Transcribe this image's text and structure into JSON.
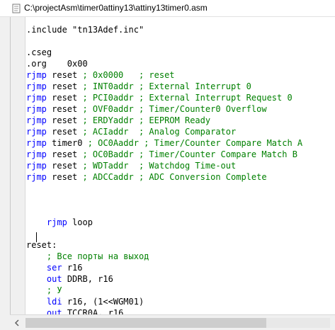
{
  "window": {
    "title": "C:\\projectAsm\\timer0attiny13\\attiny13timer0.asm",
    "icon": "document-icon"
  },
  "colors": {
    "keyword": "#0000ff",
    "comment": "#008000",
    "text": "#000000",
    "background": "#ffffff"
  },
  "code": {
    "lines": [
      [
        {
          "t": ".include \"tn13Adef.inc\"",
          "c": "plain"
        }
      ],
      [
        {
          "t": "",
          "c": "plain"
        }
      ],
      [
        {
          "t": ".cseg",
          "c": "plain"
        }
      ],
      [
        {
          "t": ".org    0x00",
          "c": "plain"
        }
      ],
      [
        {
          "t": "rjmp",
          "c": "kw"
        },
        {
          "t": " reset ",
          "c": "plain"
        },
        {
          "t": "; 0x0000   ; reset",
          "c": "cm"
        }
      ],
      [
        {
          "t": "rjmp",
          "c": "kw"
        },
        {
          "t": " reset ",
          "c": "plain"
        },
        {
          "t": "; INT0addr ; External Interrupt 0",
          "c": "cm"
        }
      ],
      [
        {
          "t": "rjmp",
          "c": "kw"
        },
        {
          "t": " reset ",
          "c": "plain"
        },
        {
          "t": "; PCI0addr ; External Interrupt Request 0",
          "c": "cm"
        }
      ],
      [
        {
          "t": "rjmp",
          "c": "kw"
        },
        {
          "t": " reset ",
          "c": "plain"
        },
        {
          "t": "; OVF0addr ; Timer/Counter0 Overflow",
          "c": "cm"
        }
      ],
      [
        {
          "t": "rjmp",
          "c": "kw"
        },
        {
          "t": " reset ",
          "c": "plain"
        },
        {
          "t": "; ERDYaddr ; EEPROM Ready",
          "c": "cm"
        }
      ],
      [
        {
          "t": "rjmp",
          "c": "kw"
        },
        {
          "t": " reset ",
          "c": "plain"
        },
        {
          "t": "; ACIaddr  ; Analog Comparator",
          "c": "cm"
        }
      ],
      [
        {
          "t": "rjmp",
          "c": "kw"
        },
        {
          "t": " timer0 ",
          "c": "plain"
        },
        {
          "t": "; OC0Aaddr ; Timer/Counter Compare Match A",
          "c": "cm"
        }
      ],
      [
        {
          "t": "rjmp",
          "c": "kw"
        },
        {
          "t": " reset ",
          "c": "plain"
        },
        {
          "t": "; OC0Baddr ; Timer/Counter Compare Match B",
          "c": "cm"
        }
      ],
      [
        {
          "t": "rjmp",
          "c": "kw"
        },
        {
          "t": " reset ",
          "c": "plain"
        },
        {
          "t": "; WDTaddr  ; Watchdog Time-out",
          "c": "cm"
        }
      ],
      [
        {
          "t": "rjmp",
          "c": "kw"
        },
        {
          "t": " reset ",
          "c": "plain"
        },
        {
          "t": "; ADCCaddr ; ADC Conversion Complete",
          "c": "cm"
        }
      ],
      [
        {
          "t": "",
          "c": "plain"
        }
      ],
      [
        {
          "t": "",
          "c": "plain"
        }
      ],
      [
        {
          "t": "",
          "c": "plain"
        }
      ],
      [
        {
          "t": "    ",
          "c": "plain"
        },
        {
          "t": "rjmp",
          "c": "kw"
        },
        {
          "t": " loop",
          "c": "plain"
        }
      ],
      [
        {
          "t": "",
          "c": "plain"
        }
      ],
      [
        {
          "t": "reset:",
          "c": "plain"
        }
      ],
      [
        {
          "t": "    ",
          "c": "plain"
        },
        {
          "t": "; Все порты на выход",
          "c": "cm"
        }
      ],
      [
        {
          "t": "    ",
          "c": "plain"
        },
        {
          "t": "ser",
          "c": "kw"
        },
        {
          "t": " r16",
          "c": "plain"
        }
      ],
      [
        {
          "t": "    ",
          "c": "plain"
        },
        {
          "t": "out",
          "c": "kw"
        },
        {
          "t": " DDRB, r16",
          "c": "plain"
        }
      ],
      [
        {
          "t": "    ",
          "c": "plain"
        },
        {
          "t": "; У",
          "c": "cm"
        }
      ],
      [
        {
          "t": "    ",
          "c": "plain"
        },
        {
          "t": "ldi",
          "c": "kw"
        },
        {
          "t": " r16, (1<<WGM01)",
          "c": "plain"
        }
      ],
      [
        {
          "t": "    ",
          "c": "plain"
        },
        {
          "t": "out",
          "c": "kw"
        },
        {
          "t": " TCCR0A, r16",
          "c": "plain"
        }
      ]
    ]
  },
  "scrollbar": {
    "left_arrow_icon": "chevron-left-icon"
  }
}
